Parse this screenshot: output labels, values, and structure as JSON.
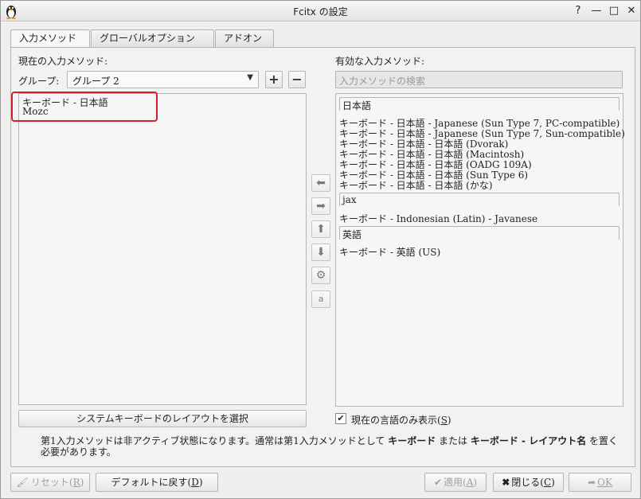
{
  "window": {
    "title": "Fcitx の設定",
    "controls": {
      "help": "?",
      "minimize": "—",
      "maximize": "□",
      "close": "✕"
    }
  },
  "tabs": [
    {
      "label": "入力メソッド",
      "active": true
    },
    {
      "label": "グローバルオプション",
      "active": false
    },
    {
      "label": "アドオン",
      "active": false
    }
  ],
  "left": {
    "heading": "現在の入力メソッド:",
    "group_label": "グループ:",
    "group_value": "グループ 2",
    "add_label": "+",
    "remove_label": "−",
    "items": [
      "キーボード - 日本語",
      "Mozc"
    ],
    "layout_button": "システムキーボードのレイアウトを選択"
  },
  "right": {
    "heading": "有効な入力メソッド:",
    "search_placeholder": "入力メソッドの検索",
    "groups": [
      {
        "name": "日本語",
        "items": [
          "キーボード - 日本語 - Japanese (Sun Type 7, PC-compatible)",
          "キーボード - 日本語 - Japanese (Sun Type 7, Sun-compatible)",
          "キーボード - 日本語 - 日本語 (Dvorak)",
          "キーボード - 日本語 - 日本語 (Macintosh)",
          "キーボード - 日本語 - 日本語 (OADG 109A)",
          "キーボード - 日本語 - 日本語 (Sun Type 6)",
          "キーボード - 日本語 - 日本語 (かな)"
        ]
      },
      {
        "name": "jax",
        "items": [
          "キーボード - Indonesian (Latin) - Javanese"
        ]
      },
      {
        "name": "英語",
        "items": [
          "キーボード - 英語 (US)"
        ]
      }
    ],
    "only_current_language": {
      "label_prefix": "現在の言語のみ表示(",
      "key": "S",
      "label_suffix": ")",
      "checked": true
    }
  },
  "middle_buttons": [
    {
      "icon": "arrow-left-icon",
      "glyph": "⬅"
    },
    {
      "icon": "arrow-right-icon",
      "glyph": "➡"
    },
    {
      "icon": "arrow-up-icon",
      "glyph": "⬆"
    },
    {
      "icon": "arrow-down-icon",
      "glyph": "⬇"
    },
    {
      "icon": "gear-icon",
      "glyph": "⚙"
    },
    {
      "icon": "keyboard-layout-icon",
      "glyph": "a"
    }
  ],
  "info": {
    "part1": "第1入力メソッドは非アクティブ状態になります。通常は第1入力メソッドとして ",
    "bold1": "キーボード",
    "part2": " または ",
    "bold2": "キーボード - レイアウト名",
    "part3": " を置く必要があります。"
  },
  "bottom": {
    "reset": {
      "prefix": "リセット(",
      "key": "R",
      "suffix": ")"
    },
    "defaults": {
      "prefix": "デフォルトに戻す(",
      "key": "D",
      "suffix": ")"
    },
    "apply": {
      "prefix": "適用(",
      "key": "A",
      "suffix": ")"
    },
    "close": {
      "prefix": "閉じる(",
      "key": "C",
      "suffix": ")"
    },
    "ok": "OK"
  }
}
